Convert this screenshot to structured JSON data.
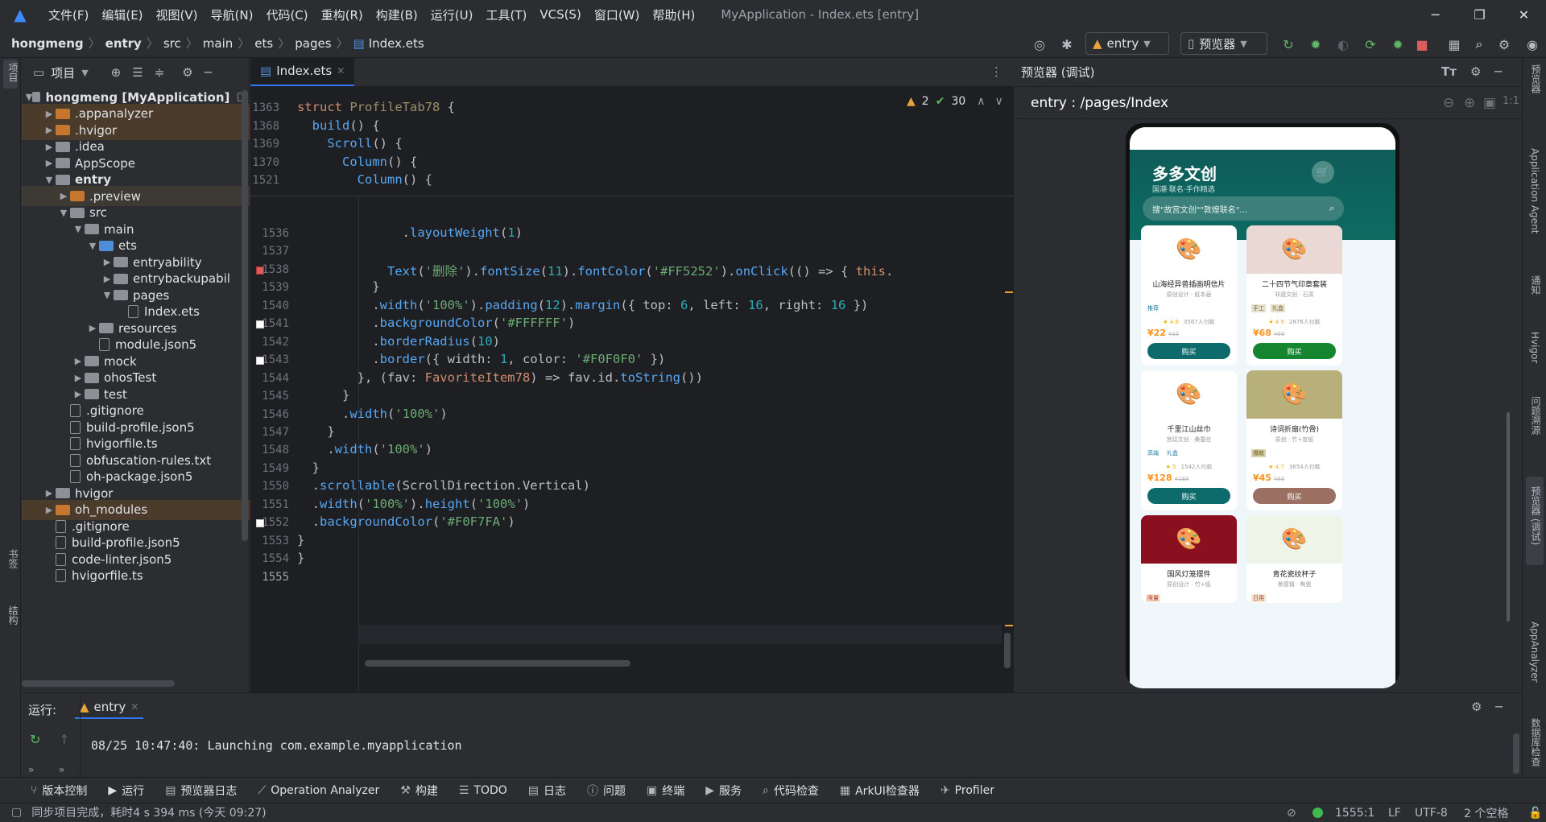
{
  "menubar": {
    "items": [
      "文件(F)",
      "编辑(E)",
      "视图(V)",
      "导航(N)",
      "代码(C)",
      "重构(R)",
      "构建(B)",
      "运行(U)",
      "工具(T)",
      "VCS(S)",
      "窗口(W)",
      "帮助(H)"
    ],
    "window_title": "MyApplication - Index.ets [entry]"
  },
  "breadcrumb": [
    "hongmeng",
    "entry",
    "src",
    "main",
    "ets",
    "pages",
    "Index.ets"
  ],
  "toolbar": {
    "run_config": "entry",
    "device": "预览器"
  },
  "project": {
    "title": "项目",
    "tree": [
      {
        "label": "hongmeng [MyApplication]",
        "suffix": "D:",
        "depth": 0,
        "type": "root",
        "open": true
      },
      {
        "label": ".appanalyzer",
        "depth": 1,
        "type": "orange",
        "open": false
      },
      {
        "label": ".hvigor",
        "depth": 1,
        "type": "orange",
        "open": false
      },
      {
        "label": ".idea",
        "depth": 1,
        "type": "gray",
        "open": false
      },
      {
        "label": "AppScope",
        "depth": 1,
        "type": "gray",
        "open": false
      },
      {
        "label": "entry",
        "depth": 1,
        "type": "gray",
        "open": true
      },
      {
        "label": ".preview",
        "depth": 2,
        "type": "orange",
        "open": false
      },
      {
        "label": "src",
        "depth": 2,
        "type": "gray",
        "open": true
      },
      {
        "label": "main",
        "depth": 3,
        "type": "gray",
        "open": true
      },
      {
        "label": "ets",
        "depth": 4,
        "type": "blue",
        "open": true
      },
      {
        "label": "entryability",
        "depth": 5,
        "type": "gray",
        "open": false
      },
      {
        "label": "entrybackupabil",
        "depth": 5,
        "type": "gray",
        "open": false
      },
      {
        "label": "pages",
        "depth": 5,
        "type": "gray",
        "open": true
      },
      {
        "label": "Index.ets",
        "depth": 6,
        "type": "file"
      },
      {
        "label": "resources",
        "depth": 4,
        "type": "gray",
        "open": false
      },
      {
        "label": "module.json5",
        "depth": 4,
        "type": "file"
      },
      {
        "label": "mock",
        "depth": 3,
        "type": "gray",
        "open": false
      },
      {
        "label": "ohosTest",
        "depth": 3,
        "type": "gray",
        "open": false
      },
      {
        "label": "test",
        "depth": 3,
        "type": "gray",
        "open": false
      },
      {
        "label": ".gitignore",
        "depth": 2,
        "type": "file"
      },
      {
        "label": "build-profile.json5",
        "depth": 2,
        "type": "file"
      },
      {
        "label": "hvigorfile.ts",
        "depth": 2,
        "type": "file"
      },
      {
        "label": "obfuscation-rules.txt",
        "depth": 2,
        "type": "file"
      },
      {
        "label": "oh-package.json5",
        "depth": 2,
        "type": "file"
      },
      {
        "label": "hvigor",
        "depth": 1,
        "type": "gray",
        "open": false
      },
      {
        "label": "oh_modules",
        "depth": 1,
        "type": "orange",
        "open": false
      },
      {
        "label": ".gitignore",
        "depth": 1,
        "type": "file"
      },
      {
        "label": "build-profile.json5",
        "depth": 1,
        "type": "file"
      },
      {
        "label": "code-linter.json5",
        "depth": 1,
        "type": "file"
      },
      {
        "label": "hvigorfile.ts",
        "depth": 1,
        "type": "file"
      }
    ]
  },
  "editor": {
    "tab": "Index.ets",
    "warnings": "2",
    "checks": "30",
    "sticky_lines": [
      "1363",
      "1368",
      "1369",
      "1370",
      "1521"
    ],
    "line_numbers": [
      "1536",
      "1537",
      "1538",
      "1539",
      "1540",
      "1541",
      "1542",
      "1543",
      "1544",
      "1545",
      "1546",
      "1547",
      "1548",
      "1549",
      "1550",
      "1551",
      "1552",
      "1553",
      "1554",
      "1555"
    ]
  },
  "preview": {
    "title": "预览器 (调试)",
    "route": "entry : /pages/Index",
    "app": {
      "title": "多多文创",
      "subtitle": "国潮·联名·手作精选",
      "search": "搜\"故宫文创\"\"敦煌联名\"...",
      "cards": [
        {
          "name": "山海经异兽插画明信片",
          "sub": "原创设计 · 纸本画",
          "tags": [
            "推荐"
          ],
          "rating": "★ 4.8",
          "sales": "3567人付款",
          "price": "¥22",
          "old": "¥35",
          "buy": "购买",
          "img_bg": "#ffffff",
          "btn": "#0d6b6b",
          "tagbg": "#fff",
          "tagc": "#1a7aa0"
        },
        {
          "name": "二十四节气印章套装",
          "sub": "非遗文创 · 石质",
          "tags": [
            "手工",
            "礼盒"
          ],
          "rating": "★ 4.9",
          "sales": "2876人付款",
          "price": "¥68",
          "old": "¥98",
          "buy": "购买",
          "img_bg": "#ead8d5",
          "btn": "#15862f",
          "tagbg": "#e6e2cf",
          "tagc": "#7b6a3a"
        },
        {
          "name": "千里江山丝巾",
          "sub": "宫廷文创 · 桑蚕丝",
          "tags": [
            "高端",
            "礼盒"
          ],
          "rating": "★ 5",
          "sales": "1542人付款",
          "price": "¥128",
          "old": "¥188",
          "buy": "购买",
          "img_bg": "#ffffff",
          "btn": "#0d6b6b",
          "tagbg": "#fff",
          "tagc": "#1a7aa0"
        },
        {
          "name": "诗词折扇(竹骨)",
          "sub": "原创 · 竹+宣纸",
          "tags": [
            "爆款"
          ],
          "rating": "★ 4.7",
          "sales": "3654人付款",
          "price": "¥45",
          "old": "¥68",
          "buy": "购买",
          "img_bg": "#b8b07a",
          "btn": "#9c6f63",
          "tagbg": "#d9d2a8",
          "tagc": "#6b5b2a"
        },
        {
          "name": "国风灯笼摆件",
          "sub": "原创设计 · 竹+纸",
          "tags": [
            "限量"
          ],
          "img_bg": "#8a0f1f"
        },
        {
          "name": "青花瓷纹杯子",
          "sub": "景德镇 · 陶瓷",
          "tags": [
            "日用"
          ],
          "img_bg": "#eef5e8"
        }
      ]
    }
  },
  "run": {
    "label": "运行:",
    "config": "entry",
    "log": "08/25 10:47:40: Launching com.example.myapplication"
  },
  "toolwindows": [
    "版本控制",
    "运行",
    "预览器日志",
    "Operation Analyzer",
    "构建",
    "TODO",
    "日志",
    "问题",
    "终端",
    "服务",
    "代码检查",
    "ArkUI检查器",
    "Profiler"
  ],
  "status": {
    "message": "同步项目完成，耗时4 s 394 ms (今天 09:27)",
    "position": "1555:1",
    "line_sep": "LF",
    "encoding": "UTF-8",
    "indent": "2 个空格"
  },
  "right_tools": [
    "预览器",
    "Application Agent",
    "通知",
    "Hvigor",
    "问题溯源",
    "预览器 (调试)",
    "AppAnalyzer",
    "数据库检查"
  ],
  "left_tools": [
    "项目",
    "书签",
    "结构"
  ]
}
